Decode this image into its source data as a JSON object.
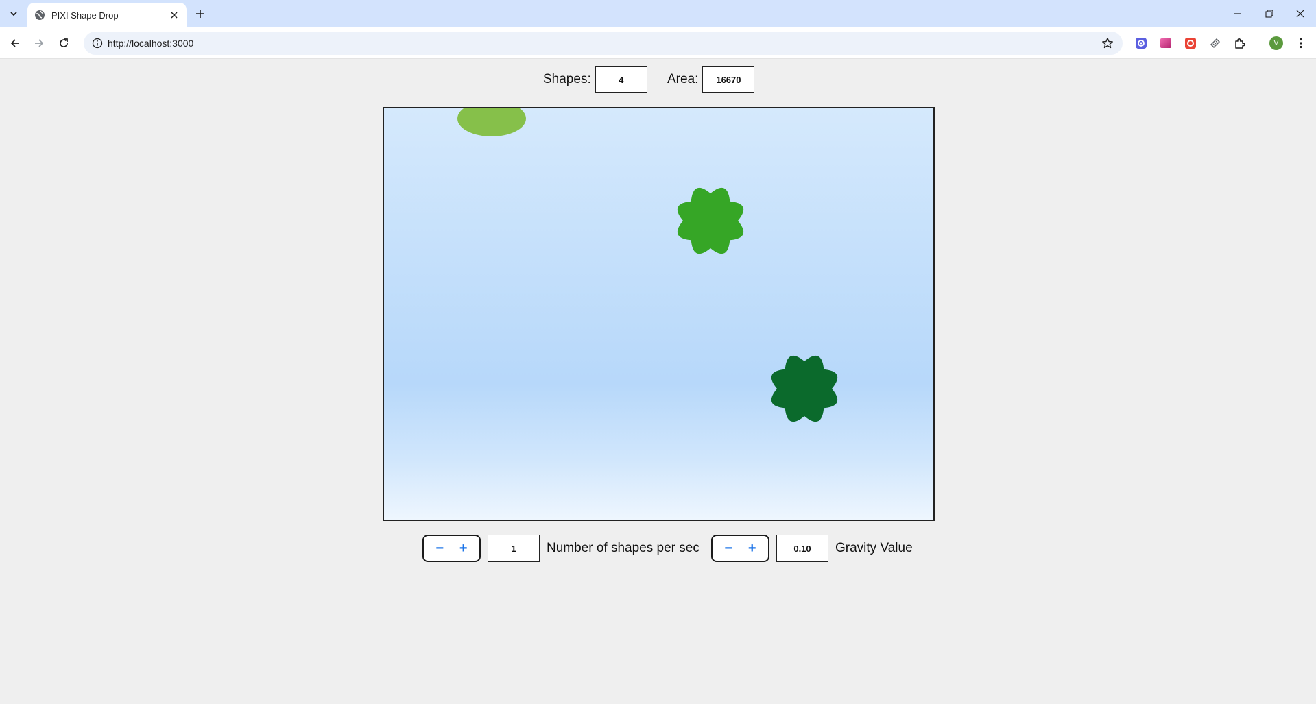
{
  "browser": {
    "tab_title": "PIXI Shape Drop",
    "url": "http://localhost:3000",
    "avatar_letter": "V"
  },
  "stats": {
    "shapes_label": "Shapes:",
    "shapes_value": "4",
    "area_label": "Area:",
    "area_value": "16670"
  },
  "stage": {
    "shapes": [
      {
        "kind": "ellipse",
        "color": "#86c04a"
      },
      {
        "kind": "flower",
        "petals": 8,
        "color": "#36a626"
      },
      {
        "kind": "flower",
        "petals": 8,
        "color": "#0b6a2c"
      }
    ]
  },
  "controls": {
    "rate": {
      "minus": "−",
      "plus": "+",
      "value": "1",
      "label": "Number of shapes per sec"
    },
    "gravity": {
      "minus": "−",
      "plus": "+",
      "value": "0.10",
      "label": "Gravity Value"
    }
  },
  "colors": {
    "tabbar_bg": "#d3e3fd",
    "page_bg": "#efefef",
    "accent": "#1a73e8"
  }
}
